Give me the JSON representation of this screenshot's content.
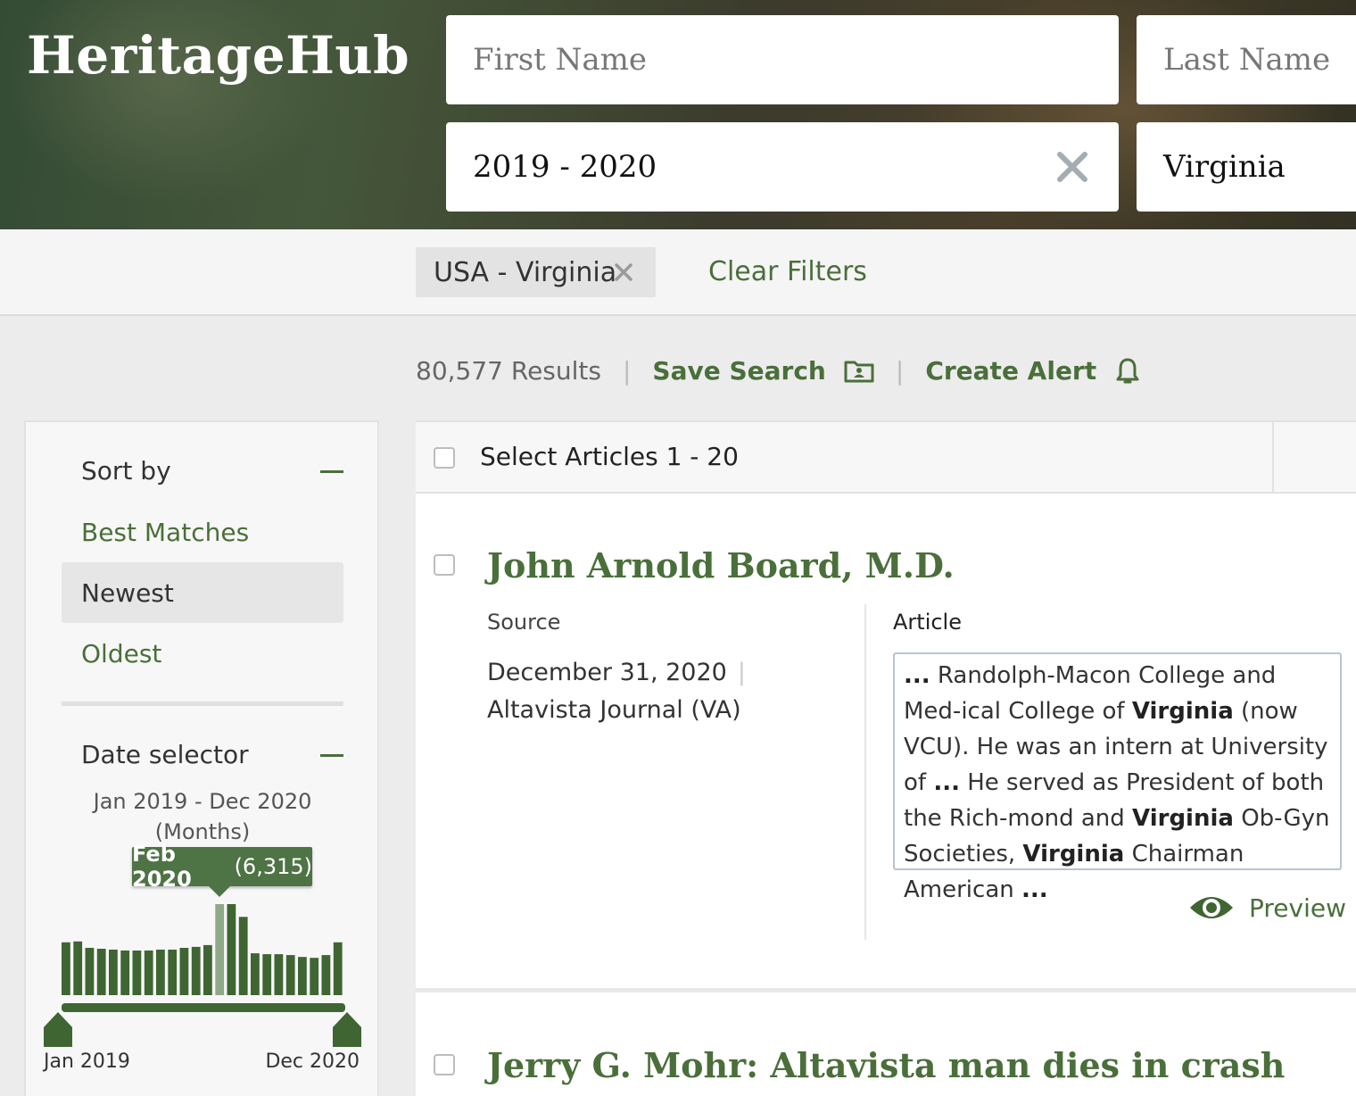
{
  "app": {
    "logo": "HeritageHub"
  },
  "search": {
    "first_name_placeholder": "First Name",
    "last_name_placeholder": "Last Name",
    "date_value": "2019 - 2020",
    "location_value": "Virginia"
  },
  "filters": {
    "chips": [
      {
        "label": "USA - Virginia"
      }
    ],
    "clear_label": "Clear Filters"
  },
  "results_meta": {
    "count": "80,577 Results",
    "save_search": "Save Search",
    "create_alert": "Create Alert"
  },
  "sidebar": {
    "sort": {
      "title": "Sort by",
      "options": [
        {
          "label": "Best Matches",
          "active": false
        },
        {
          "label": "Newest",
          "active": true
        },
        {
          "label": "Oldest",
          "active": false
        }
      ]
    },
    "date_selector": {
      "title": "Date selector",
      "range_line1": "Jan 2019 - Dec 2020",
      "range_line2": "(Months)",
      "tooltip_month": "Feb 2020",
      "tooltip_count": "(6,315)",
      "start_label": "Jan 2019",
      "end_label": "Dec 2020",
      "highlight_index": 13,
      "month_levels": [
        0.58,
        0.59,
        0.52,
        0.51,
        0.5,
        0.49,
        0.49,
        0.49,
        0.5,
        0.5,
        0.52,
        0.53,
        0.55,
        1.0,
        1.0,
        0.86,
        0.46,
        0.45,
        0.45,
        0.44,
        0.42,
        0.41,
        0.44,
        0.58
      ],
      "accent_color": "#3f6533"
    }
  },
  "results": {
    "select_label": "Select Articles 1 - 20",
    "items": [
      {
        "title": "John Arnold Board, M.D.",
        "source_label": "Source",
        "date": "December 31, 2020",
        "publication": "Altavista Journal (VA)",
        "article_label": "Article",
        "snippet_html": "<b>...</b> Randolph-Macon College and Med-ical College of <b>Virginia</b> (now VCU). He was an intern at University of <b>...</b> He served as President of both the Rich-mond and <b>Virginia</b> Ob-Gyn Societies, <b>Virginia</b> Chairman American <b>...</b>",
        "preview_label": "Preview"
      },
      {
        "title": "Jerry G. Mohr: Altavista man dies in crash"
      }
    ]
  },
  "colors": {
    "brand_green": "#4a6f3a",
    "chart_green": "#3f6533"
  }
}
